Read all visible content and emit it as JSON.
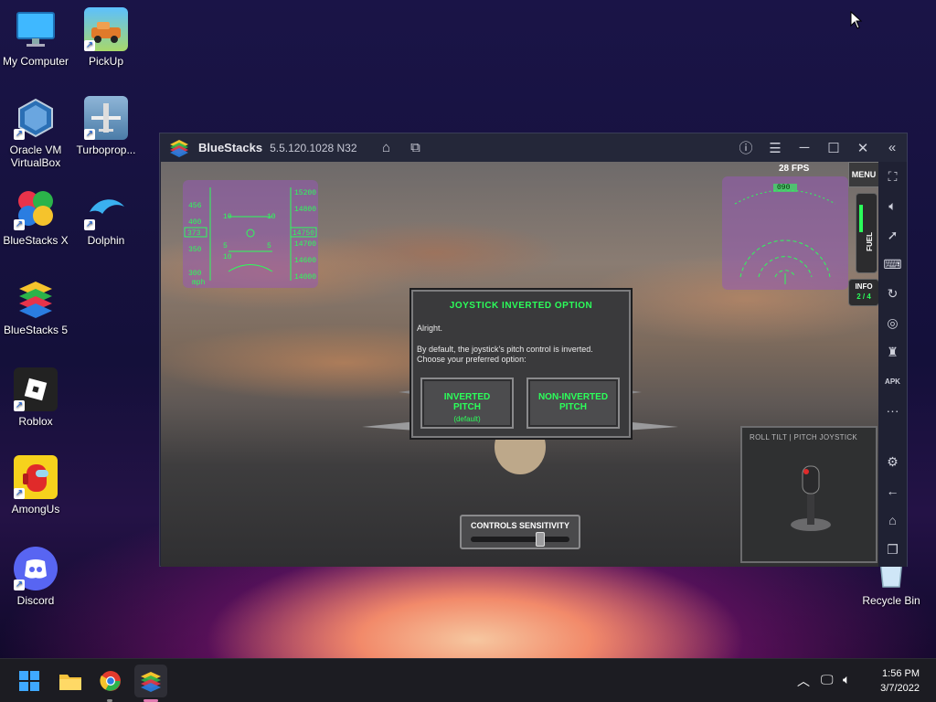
{
  "desktop": {
    "icons": [
      {
        "label": "My Computer",
        "icon": "monitor-icon"
      },
      {
        "label": "PickUp",
        "icon": "pickup-game-icon"
      },
      {
        "label": "Oracle VM\nVirtualBox",
        "label_line1": "Oracle VM",
        "label_line2": "VirtualBox",
        "icon": "virtualbox-icon"
      },
      {
        "label": "Turboprop...",
        "icon": "turboprop-icon"
      },
      {
        "label": "BlueStacks X",
        "icon": "bluestacks-x-icon"
      },
      {
        "label": "Dolphin",
        "icon": "dolphin-icon"
      },
      {
        "label": "BlueStacks 5",
        "icon": "bluestacks-5-icon"
      },
      {
        "label": "Roblox",
        "icon": "roblox-icon"
      },
      {
        "label": "AmongUs",
        "icon": "among-us-icon"
      },
      {
        "label": "Discord",
        "icon": "discord-icon"
      },
      {
        "label": "Recycle Bin",
        "icon": "recycle-bin-icon"
      }
    ]
  },
  "window": {
    "app_name": "BlueStacks",
    "version": "5.5.120.1028  N32",
    "titlebar_icons": [
      "home-icon",
      "multi-instance-icon",
      "help-icon",
      "menu-icon",
      "minimize-icon",
      "maximize-icon",
      "close-icon",
      "collapse-sidebar-icon"
    ],
    "sidebar_icons": [
      "fullscreen-icon",
      "volume-icon",
      "pointer-icon",
      "keyboard-icon",
      "rotate-icon",
      "camera-icon",
      "build-icon",
      "apk-icon",
      "more-icon",
      "settings-icon",
      "back-icon",
      "home-icon",
      "recent-apps-icon"
    ],
    "sidebar_apk_label": "APK",
    "sidebar_more_label": "···"
  },
  "game": {
    "fps": "28 FPS",
    "menu_label": "MENU",
    "fuel_label": "FUEL",
    "info_label": "INFO",
    "info_sub": "2 / 4",
    "hud_left": {
      "speed_values": [
        "456",
        "400",
        "373",
        "350",
        "300"
      ],
      "speed_unit": "mph",
      "pitch_values": [
        "10",
        "10",
        "5",
        "5",
        "10"
      ],
      "alt_values": [
        "15200",
        "14800",
        "14750",
        "14700",
        "14600",
        "14000"
      ]
    },
    "hud_right": {
      "heading_box": "090"
    },
    "dialog": {
      "title": "JOYSTICK INVERTED OPTION",
      "line1": "Alright.",
      "line2": "By default, the joystick's pitch control is inverted.",
      "line3": "Choose your preferred option:",
      "option_inverted": "INVERTED PITCH",
      "option_inverted_line1": "INVERTED",
      "option_inverted_line2": "PITCH",
      "option_inverted_sub": "(default)",
      "option_noninverted_line1": "NON-INVERTED",
      "option_noninverted_line2": "PITCH"
    },
    "sensitivity": {
      "label": "CONTROLS SENSITIVITY",
      "level": 0.78
    },
    "joystick_panel": {
      "header": "ROLL TILT  |  PITCH JOYSTICK"
    }
  },
  "taskbar": {
    "apps": [
      "windows-start-icon",
      "file-explorer-icon",
      "chrome-icon",
      "bluestacks-icon"
    ],
    "tray_icons": [
      "chevron-up-icon",
      "network-icon",
      "volume-icon"
    ],
    "time": "1:56 PM",
    "date": "3/7/2022"
  },
  "colors": {
    "hud_green": "#2bff5a",
    "window_bg": "#242739",
    "taskbar_bg": "#1c1c22"
  }
}
